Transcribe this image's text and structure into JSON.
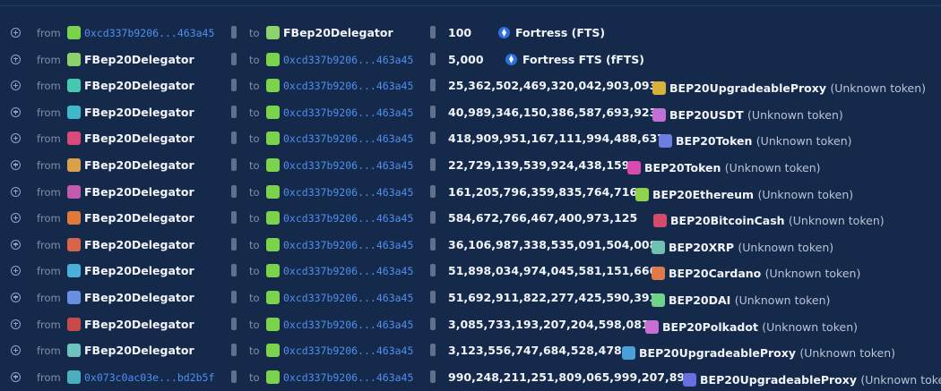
{
  "labels": {
    "from": "from",
    "to": "to"
  },
  "rows": [
    {
      "from": "0xcd337b9206...463a45",
      "from_is_addr": true,
      "to": "FBep20Delegator",
      "to_is_addr": false,
      "amount": "100",
      "token": "Fortress (FTS)",
      "token_extra": "",
      "fts": true,
      "from_color": "#7ad34a",
      "to_color": "#8bd36a",
      "tok_color": "#2f6fe0"
    },
    {
      "from": "FBep20Delegator",
      "from_is_addr": false,
      "to": "0xcd337b9206...463a45",
      "to_is_addr": true,
      "amount": "5,000",
      "token": "Fortress FTS (fFTS)",
      "token_extra": "",
      "fts": true,
      "from_color": "#8bd36a",
      "to_color": "#7ad34a",
      "tok_color": "#2f6fe0"
    },
    {
      "from": "FBep20Delegator",
      "from_is_addr": false,
      "to": "0xcd337b9206...463a45",
      "to_is_addr": true,
      "amount": "25,362,502,469,320,042,903,093",
      "token": "BEP20UpgradeableProxy",
      "token_extra": "(Unknown token)",
      "fts": false,
      "from_color": "#46c9b0",
      "to_color": "#7ad34a",
      "tok_color": "#d8b13a"
    },
    {
      "from": "FBep20Delegator",
      "from_is_addr": false,
      "to": "0xcd337b9206...463a45",
      "to_is_addr": true,
      "amount": "40,989,346,150,386,587,693,923",
      "token": "BEP20USDT",
      "token_extra": "(Unknown token)",
      "fts": false,
      "from_color": "#3fb9c9",
      "to_color": "#7ad34a",
      "tok_color": "#c26fd6"
    },
    {
      "from": "FBep20Delegator",
      "from_is_addr": false,
      "to": "0xcd337b9206...463a45",
      "to_is_addr": true,
      "amount": "418,909,951,167,111,994,488,637",
      "token": "BEP20Token",
      "token_extra": "(Unknown token)",
      "fts": false,
      "from_color": "#d84a7a",
      "to_color": "#7ad34a",
      "tok_color": "#6a7fe0"
    },
    {
      "from": "FBep20Delegator",
      "from_is_addr": false,
      "to": "0xcd337b9206...463a45",
      "to_is_addr": true,
      "amount": "22,729,139,539,924,438,159",
      "token": "BEP20Token",
      "token_extra": "(Unknown token)",
      "fts": false,
      "from_color": "#d9a24a",
      "to_color": "#7ad34a",
      "tok_color": "#d84ab0"
    },
    {
      "from": "FBep20Delegator",
      "from_is_addr": false,
      "to": "0xcd337b9206...463a45",
      "to_is_addr": true,
      "amount": "161,205,796,359,835,764,716",
      "token": "BEP20Ethereum",
      "token_extra": "(Unknown token)",
      "fts": false,
      "from_color": "#c25ab0",
      "to_color": "#7ad34a",
      "tok_color": "#8fd34a"
    },
    {
      "from": "FBep20Delegator",
      "from_is_addr": false,
      "to": "0xcd337b9206...463a45",
      "to_is_addr": true,
      "amount": "584,672,766,467,400,973,125",
      "token": "BEP20BitcoinCash",
      "token_extra": "(Unknown token)",
      "fts": false,
      "from_color": "#e07a3a",
      "to_color": "#7ad34a",
      "tok_color": "#d64a6a"
    },
    {
      "from": "FBep20Delegator",
      "from_is_addr": false,
      "to": "0xcd337b9206...463a45",
      "to_is_addr": true,
      "amount": "36,106,987,338,535,091,504,008",
      "token": "BEP20XRP",
      "token_extra": "(Unknown token)",
      "fts": false,
      "from_color": "#d8644a",
      "to_color": "#7ad34a",
      "tok_color": "#6fc0b0"
    },
    {
      "from": "FBep20Delegator",
      "from_is_addr": false,
      "to": "0xcd337b9206...463a45",
      "to_is_addr": true,
      "amount": "51,898,034,974,045,581,151,666",
      "token": "BEP20Cardano",
      "token_extra": "(Unknown token)",
      "fts": false,
      "from_color": "#4ab0d8",
      "to_color": "#7ad34a",
      "tok_color": "#e07a4a"
    },
    {
      "from": "FBep20Delegator",
      "from_is_addr": false,
      "to": "0xcd337b9206...463a45",
      "to_is_addr": true,
      "amount": "51,692,911,822,277,425,590,393",
      "token": "BEP20DAI",
      "token_extra": "(Unknown token)",
      "fts": false,
      "from_color": "#6a8fe0",
      "to_color": "#7ad34a",
      "tok_color": "#6fd38a"
    },
    {
      "from": "FBep20Delegator",
      "from_is_addr": false,
      "to": "0xcd337b9206...463a45",
      "to_is_addr": true,
      "amount": "3,085,733,193,207,204,598,081",
      "token": "BEP20Polkadot",
      "token_extra": "(Unknown token)",
      "fts": false,
      "from_color": "#c84a4a",
      "to_color": "#7ad34a",
      "tok_color": "#c86fd6"
    },
    {
      "from": "FBep20Delegator",
      "from_is_addr": false,
      "to": "0xcd337b9206...463a45",
      "to_is_addr": true,
      "amount": "3,123,556,747,684,528,478",
      "token": "BEP20UpgradeableProxy",
      "token_extra": "(Unknown token)",
      "fts": false,
      "from_color": "#6fc4c0",
      "to_color": "#7ad34a",
      "tok_color": "#4aa0d8"
    },
    {
      "from": "0x073c0ac03e...bd2b5f",
      "from_is_addr": true,
      "to": "0xcd337b9206...463a45",
      "to_is_addr": true,
      "amount": "990,248,211,251,809,065,999,207,892",
      "token": "BEP20UpgradeableProxy",
      "token_extra": "(Unknown token)",
      "fts": false,
      "from_color": "#4ab0c0",
      "to_color": "#7ad34a",
      "tok_color": "#6a6fe0"
    }
  ]
}
